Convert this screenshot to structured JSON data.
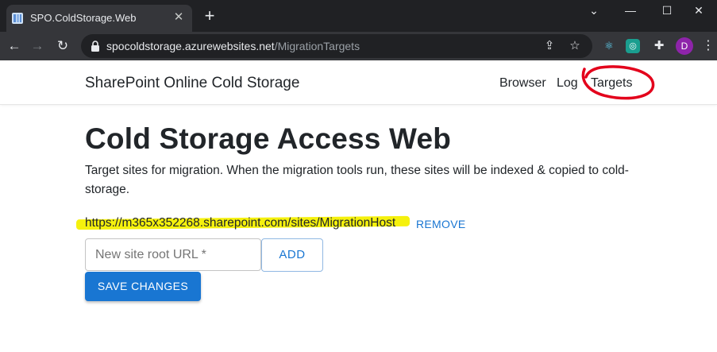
{
  "browser": {
    "tab_title": "SPO.ColdStorage.Web",
    "new_tab_label": "+",
    "url_host": "spocoldstorage.azurewebsites.net",
    "url_path": "/MigrationTargets",
    "profile_initial": "D"
  },
  "navbar": {
    "brand": "SharePoint Online Cold Storage",
    "links": [
      "Browser",
      "Log",
      "Targets"
    ]
  },
  "main": {
    "title": "Cold Storage Access Web",
    "description": "Target sites for migration. When the migration tools run, these sites will be indexed & copied to cold-storage.",
    "targets": [
      {
        "url": "https://m365x352268.sharepoint.com/sites/MigrationHost",
        "remove_label": "REMOVE"
      }
    ],
    "new_site_placeholder": "New site root URL *",
    "add_label": "ADD",
    "save_label": "SAVE CHANGES"
  },
  "colors": {
    "primary": "#1976d2",
    "annotation_circle": "#e3001b",
    "annotation_highlight": "#f4f000",
    "chrome_dark": "#202124",
    "chrome_toolbar": "#35363a"
  }
}
